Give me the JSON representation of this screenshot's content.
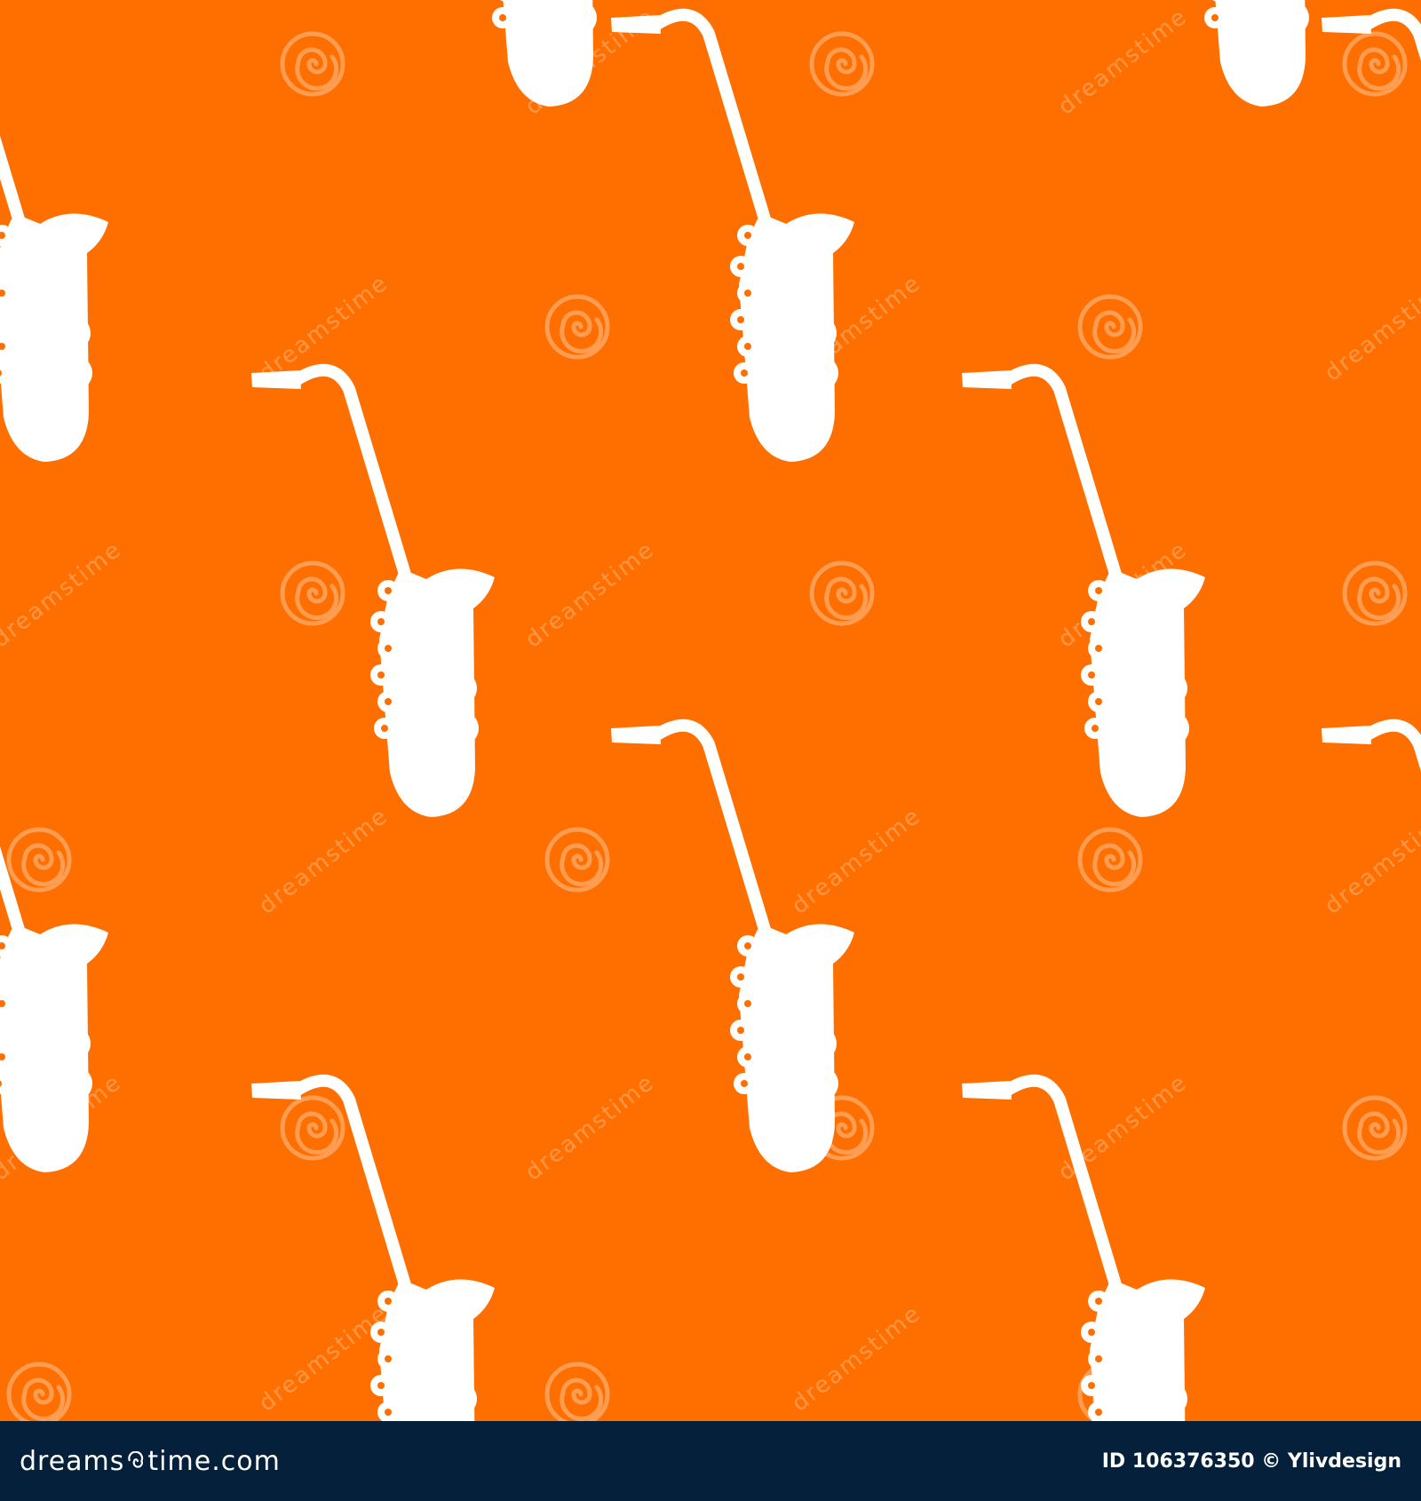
{
  "colors": {
    "background": "#ff6f00",
    "icon": "#ffffff",
    "watermark": "#ffffff",
    "footer_background": "#04203a",
    "footer_text": "#ffffff"
  },
  "pattern": {
    "icon": "saxophone-icon"
  },
  "watermark": {
    "text": "dreamstime",
    "icon": "spiral-icon"
  },
  "footer": {
    "logo_text_before": "dreams",
    "logo_text_after": "time.com",
    "logo_icon": "spiral-icon",
    "credit": "ID 106376350 © Ylivdesign"
  }
}
